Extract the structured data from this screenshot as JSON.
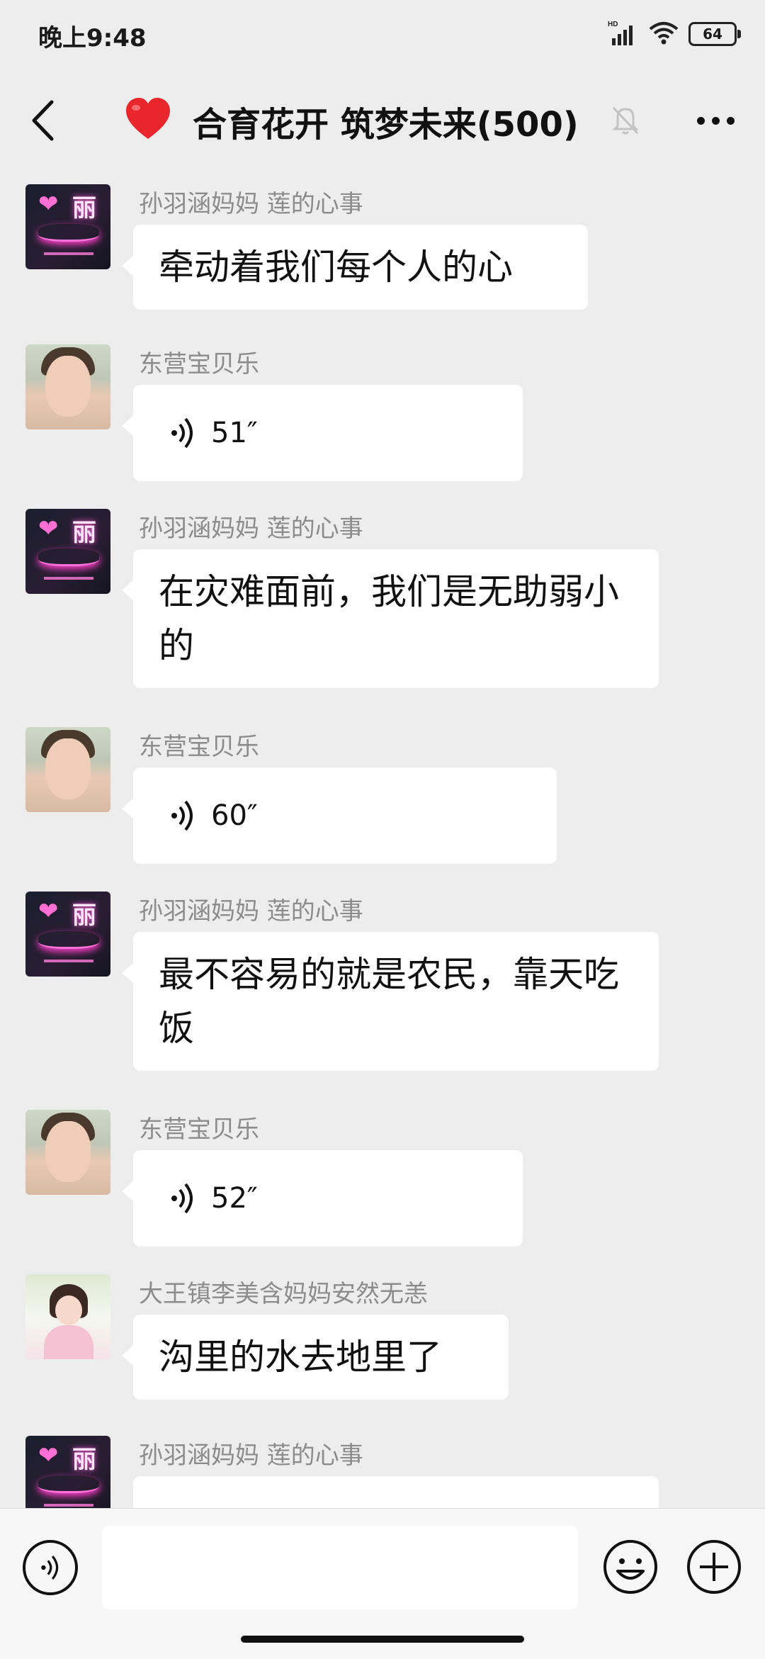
{
  "status_bar": {
    "time": "晚上9:48",
    "network": "HD",
    "battery": "64"
  },
  "header": {
    "title": "合育花开 筑梦未来(500)"
  },
  "messages": [
    {
      "sender": "孙羽涵妈妈   莲的心事",
      "text": "牵动着我们每个人的心"
    },
    {
      "sender": "东营宝贝乐",
      "voice": "51″"
    },
    {
      "sender": "孙羽涵妈妈   莲的心事",
      "text": "在灾难面前，我们是无助弱小的"
    },
    {
      "sender": "东营宝贝乐",
      "voice": "60″"
    },
    {
      "sender": "孙羽涵妈妈   莲的心事",
      "text": "最不容易的就是农民，靠天吃饭"
    },
    {
      "sender": "东营宝贝乐",
      "voice": "52″"
    },
    {
      "sender": "大王镇李美含妈妈安然无恙",
      "text": "沟里的水去地里了"
    },
    {
      "sender": "孙羽涵妈妈   莲的心事",
      "text": ""
    }
  ],
  "avatar_text": {
    "neon_heart": "❤",
    "neon_li": "丽"
  },
  "input": {
    "placeholder": ""
  },
  "colors": {
    "background": "#ededed",
    "bubble": "#ffffff",
    "sender": "#8c8c8c",
    "heart": "#e8262c"
  }
}
